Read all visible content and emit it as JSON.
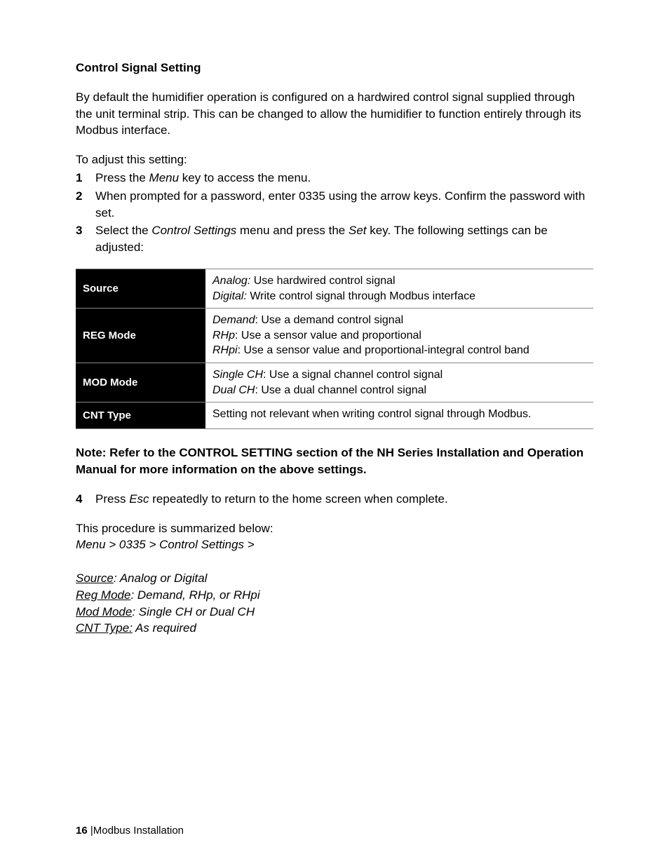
{
  "heading": "Control Signal Setting",
  "intro_para": "By default the humidifier operation is configured on a hardwired control signal supplied through the unit terminal strip.  This can be changed to allow the humidifier to function entirely through its Modbus interface.",
  "adjust_intro": "To adjust this setting:",
  "steps": {
    "s1_num": "1",
    "s1_a": "Press the ",
    "s1_menu": "Menu",
    "s1_b": " key to access the menu.",
    "s2_num": "2",
    "s2": "When prompted for a password, enter 0335 using the arrow keys.  Confirm the password with set.",
    "s3_num": "3",
    "s3_a": "Select the ",
    "s3_cs": "Control Settings",
    "s3_b": " menu and press the ",
    "s3_set": "Set",
    "s3_c": " key.  The following settings can be adjusted:"
  },
  "table": {
    "r1": {
      "name": "Source",
      "opt1_label": "Analog:",
      "opt1_text": "  Use hardwired control signal",
      "opt2_label": "Digital:",
      "opt2_text": " Write control signal through Modbus interface"
    },
    "r2": {
      "name": "REG Mode",
      "opt1_label": "Demand",
      "opt1_text": ": Use a demand control signal",
      "opt2_label": "RHp",
      "opt2_text": ": Use a sensor value and proportional",
      "opt3_label": "RHpi",
      "opt3_text": ": Use a sensor value and proportional-integral control band"
    },
    "r3": {
      "name": "MOD Mode",
      "opt1_label": "Single CH",
      "opt1_text": ": Use a signal channel control signal",
      "opt2_label": "Dual CH",
      "opt2_text": ": Use a dual channel control signal"
    },
    "r4": {
      "name": "CNT Type",
      "text": "Setting not relevant when writing control signal through Modbus."
    }
  },
  "note_bold": "Note: Refer to the CONTROL SETTING section of the NH Series Installation and Operation Manual for more information on the above settings.",
  "step4": {
    "num": "4",
    "a": "Press ",
    "esc": "Esc",
    "b": " repeatedly to return to the home screen when complete."
  },
  "summary": {
    "intro": "This procedure is summarized below:",
    "path": "Menu > 0335 > Control Settings >",
    "l1_u": "Source",
    "l1_r": ": Analog or Digital",
    "l2_u": "Reg Mode",
    "l2_r": ": Demand, RHp, or RHpi",
    "l3_u": "Mod Mode",
    "l3_r": ": Single CH or Dual CH",
    "l4_u": "CNT Type:",
    "l4_r": " As required"
  },
  "footer": {
    "page": "16",
    "sep": " |",
    "title": "Modbus Installation"
  }
}
